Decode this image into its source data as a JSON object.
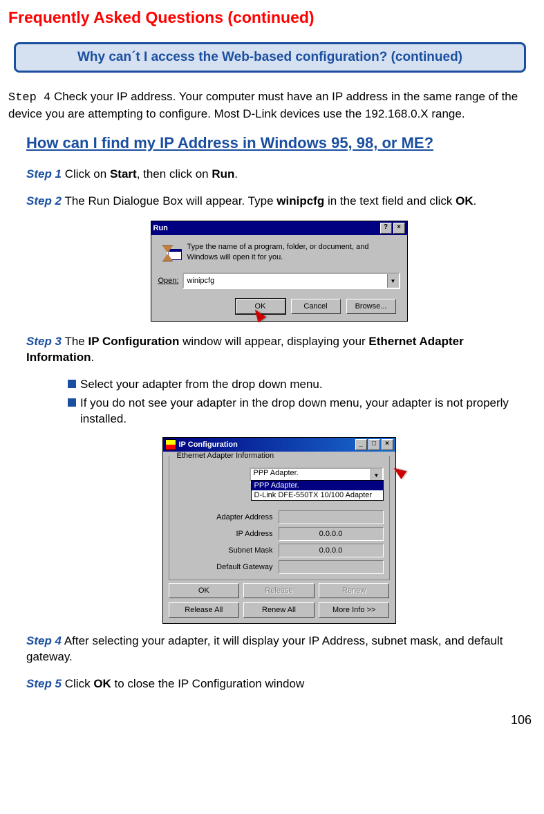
{
  "page_title": "Frequently Asked Questions (continued)",
  "callout": "Why can´t I access the Web-based configuration? (continued)",
  "step4_label": "Step 4",
  "step4_text": " Check your IP address. Your computer must have an IP address in the same range of the device you are attempting to configure. Most D-Link devices use the 192.168.0.X range.",
  "sub_heading": "How can I find my IP Address in Windows 95, 98, or ME?",
  "s1_label": "Step 1",
  "s1_a": " Click on ",
  "s1_b": "Start",
  "s1_c": ", then click on ",
  "s1_d": "Run",
  "s1_e": ".",
  "s2_label": "Step 2",
  "s2_a": " The Run Dialogue Box will appear. Type ",
  "s2_b": "winipcfg",
  "s2_c": " in the text field and click ",
  "s2_d": "OK",
  "s2_e": ".",
  "run_dialog": {
    "title": "Run",
    "help_btn": "?",
    "close_btn": "×",
    "message": "Type the name of a program, folder, or document, and Windows will open it for you.",
    "open_label": "Open:",
    "open_value": "winipcfg",
    "ok": "OK",
    "cancel": "Cancel",
    "browse": "Browse..."
  },
  "s3_label": "Step 3",
  "s3_a": " The ",
  "s3_b": "IP Configuration",
  "s3_c": " window will appear, displaying your ",
  "s3_d": "Ethernet Adapter Information",
  "s3_e": ".",
  "bullets": {
    "b1": "Select your adapter from the drop down menu.",
    "b2": "If you do not see your adapter in the drop down menu, your adapter is not properly installed."
  },
  "ip_dialog": {
    "title": "IP Configuration",
    "min_btn": "_",
    "max_btn": "□",
    "close_btn": "×",
    "group_legend": "Ethernet Adapter Information",
    "adapter_selected": "PPP Adapter.",
    "adapter_opt1": "PPP Adapter.",
    "adapter_opt2": "D-Link DFE-550TX 10/100 Adapter",
    "rows": {
      "addr_label": "Adapter Address",
      "addr_val": "",
      "ip_label": "IP Address",
      "ip_val": "0.0.0.0",
      "mask_label": "Subnet Mask",
      "mask_val": "0.0.0.0",
      "gw_label": "Default Gateway",
      "gw_val": ""
    },
    "buttons": {
      "ok": "OK",
      "release": "Release",
      "renew": "Renew",
      "release_all": "Release All",
      "renew_all": "Renew All",
      "more_info": "More Info >>"
    }
  },
  "s4_label": "Step 4",
  "s4_text": "   After selecting your adapter, it will display your IP Address, subnet mask, and default gateway.",
  "s5_label": "Step 5",
  "s5_a": "  Click ",
  "s5_b": "OK",
  "s5_c": " to close the IP Configuration window",
  "page_number": "106"
}
